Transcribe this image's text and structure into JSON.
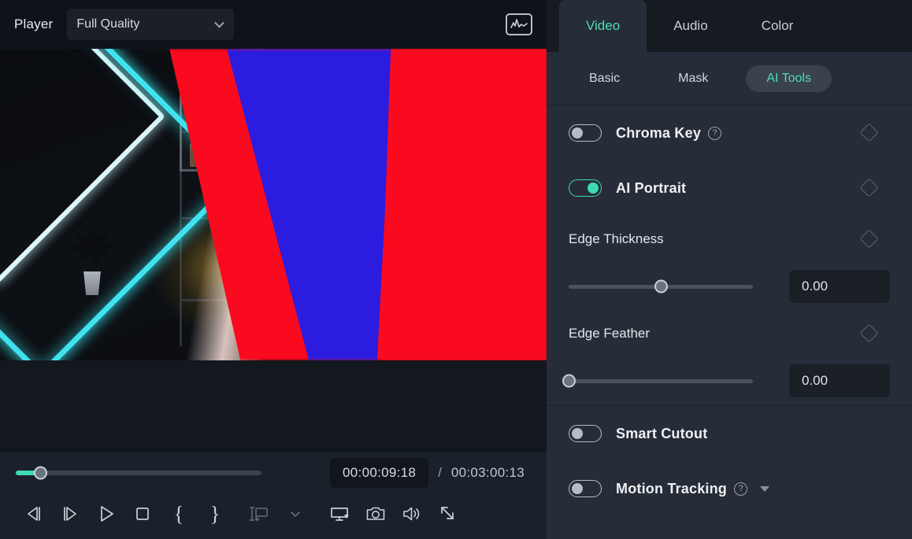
{
  "player": {
    "label": "Player",
    "quality": {
      "selected": "Full Quality",
      "icon": "chevron-down-icon"
    },
    "scope_icon": "waveform-scope-icon",
    "seek": {
      "position_pct": 10,
      "fill_color": "#3ddcb0"
    },
    "timecode": {
      "current": "00:00:09:18",
      "separator": "/",
      "total": "00:03:00:13"
    },
    "controls": [
      {
        "name": "previous-frame-button",
        "icon": "step-backward-icon"
      },
      {
        "name": "next-frame-button",
        "icon": "step-forward-icon"
      },
      {
        "name": "play-button",
        "icon": "play-icon"
      },
      {
        "name": "stop-button",
        "icon": "stop-icon"
      },
      {
        "name": "mark-in-button",
        "icon": "brace-open-icon",
        "glyph": "{"
      },
      {
        "name": "mark-out-button",
        "icon": "brace-close-icon",
        "glyph": "}"
      },
      {
        "name": "insert-to-timeline-button",
        "icon": "insert-clip-icon"
      },
      {
        "name": "insert-options-button",
        "icon": "chevron-down-icon"
      },
      {
        "name": "display-mode-button",
        "icon": "monitor-dropdown-icon"
      },
      {
        "name": "snapshot-button",
        "icon": "camera-icon"
      },
      {
        "name": "volume-button",
        "icon": "speaker-icon"
      },
      {
        "name": "fullscreen-button",
        "icon": "expand-arrows-icon"
      }
    ]
  },
  "panel": {
    "main_tabs": [
      {
        "label": "Video",
        "active": true
      },
      {
        "label": "Audio",
        "active": false
      },
      {
        "label": "Color",
        "active": false
      }
    ],
    "sub_tabs": [
      {
        "label": "Basic",
        "active": false
      },
      {
        "label": "Mask",
        "active": false
      },
      {
        "label": "AI Tools",
        "active": true
      }
    ],
    "toggles": [
      {
        "label": "Chroma Key",
        "on": false,
        "help": true,
        "keyframe": true,
        "caret": false
      },
      {
        "label": "AI Portrait",
        "on": true,
        "help": false,
        "keyframe": true,
        "caret": false
      },
      {
        "label": "Smart Cutout",
        "on": false,
        "help": false,
        "keyframe": false,
        "caret": false
      },
      {
        "label": "Motion Tracking",
        "on": false,
        "help": true,
        "keyframe": false,
        "caret": true
      }
    ],
    "sliders": [
      {
        "label": "Edge Thickness",
        "value": "0.00",
        "position_pct": 50,
        "keyframe": true
      },
      {
        "label": "Edge Feather",
        "value": "0.00",
        "position_pct": 0,
        "keyframe": true
      }
    ],
    "accent_color": "#4fddb0",
    "toggle_on_color": "#3ddcb0"
  },
  "preview": {
    "description": "video-preview-frame"
  }
}
